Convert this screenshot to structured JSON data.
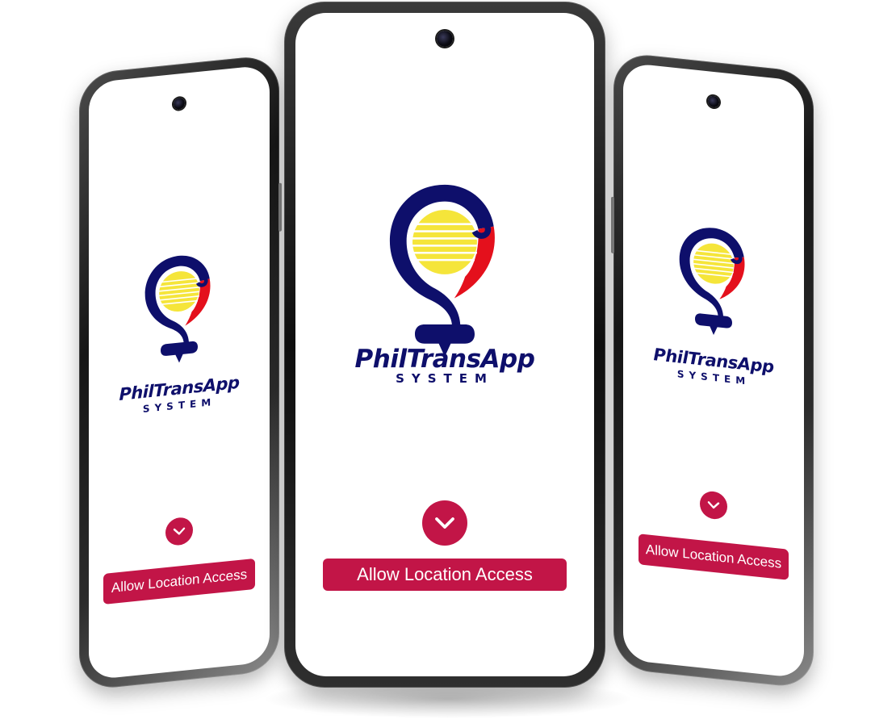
{
  "app": {
    "brand_name": "PhilTransApp",
    "brand_subtitle": "SYSTEM",
    "allow_button_label": "Allow Location Access"
  },
  "icons": {
    "chevron": "chevron-down-icon",
    "logo": "location-pin-sun-logo"
  },
  "colors": {
    "navy": "#0e0f6b",
    "sun_yellow": "#f5e53a",
    "red": "#e4101c",
    "button": "#c21547",
    "white": "#ffffff"
  }
}
